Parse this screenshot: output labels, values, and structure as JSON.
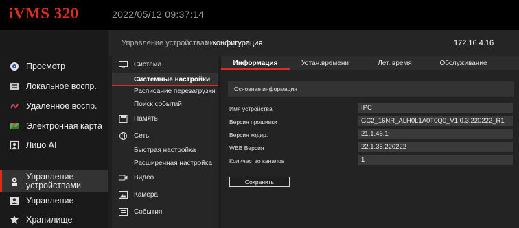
{
  "header": {
    "app_title": "iVMS 320",
    "datetime": "2022/05/12 09:37:14"
  },
  "colors": {
    "accent": "#e02b20",
    "header_bg": "#000000",
    "panel_bg": "#232323"
  },
  "nav": {
    "items": [
      {
        "label": "Просмотр",
        "icon": "live-view-icon"
      },
      {
        "label": "Локальное воспр.",
        "icon": "local-playback-icon"
      },
      {
        "label": "Удаленное воспр.",
        "icon": "remote-playback-icon"
      },
      {
        "label": "Электронная карта",
        "icon": "emap-icon"
      },
      {
        "label": "Лицо AI",
        "icon": "face-ai-icon"
      },
      {
        "label": "Управление устройствами",
        "icon": "device-management-icon",
        "active": true
      },
      {
        "label": "Управление",
        "icon": "management-icon"
      },
      {
        "label": "Хранилище",
        "icon": "storage-icon"
      }
    ]
  },
  "breadcrumb": {
    "parent": "Управление устройствами",
    "separator": ">",
    "current": "конфигурация",
    "ip": "172.16.4.16"
  },
  "config_menu": {
    "system": "Система",
    "system_settings": "Системные настройки",
    "reboot_schedule": "Расписание перезагрузки",
    "event_search": "Поиск событий",
    "memory": "Память",
    "network": "Сеть",
    "quick_setup": "Быстрая настройка",
    "advanced_setup": "Расширенная настройка",
    "video": "Видео",
    "camera": "Камера",
    "events": "События"
  },
  "tabs": [
    "Информация",
    "Устан.времени",
    "Лет. время",
    "Обслуживание"
  ],
  "info": {
    "section_title": "Основная информация",
    "fields": [
      {
        "label": "Имя устройства",
        "value": "IPC"
      },
      {
        "label": "Версия прошивки",
        "value": "GC2_16NR_ALH0L1A0T0Q0_V1.0.3.220222_R1"
      },
      {
        "label": "Версия кодир.",
        "value": "21.1.46.1"
      },
      {
        "label": "WEB Версия",
        "value": "22.1.36.220222"
      },
      {
        "label": "Количество каналов",
        "value": "1"
      }
    ],
    "save_label": "Сохранить"
  }
}
